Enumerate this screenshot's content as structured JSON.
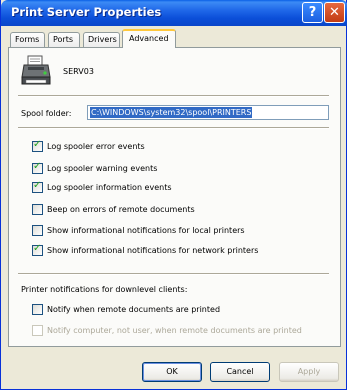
{
  "window": {
    "title": "Print Server Properties"
  },
  "title_buttons": {
    "help": "?",
    "close": "✕"
  },
  "tabs": [
    {
      "label": "Forms"
    },
    {
      "label": "Ports"
    },
    {
      "label": "Drivers"
    },
    {
      "label": "Advanced"
    }
  ],
  "server": {
    "name": "SERV03"
  },
  "spool": {
    "label": "Spool folder:",
    "value": "C:\\WINDOWS\\system32\\spool\\PRINTERS"
  },
  "options": [
    {
      "label": "Log spooler error events",
      "checked": true
    },
    {
      "label": "Log spooler warning events",
      "checked": true
    },
    {
      "label": "Log spooler information events",
      "checked": true
    },
    {
      "label": "Beep on errors of remote documents",
      "checked": false
    },
    {
      "label": "Show informational notifications for local printers",
      "checked": false
    },
    {
      "label": "Show informational notifications for network printers",
      "checked": true
    }
  ],
  "downlevel": {
    "heading": "Printer notifications for downlevel clients:",
    "notify_remote": {
      "label": "Notify when remote documents are printed",
      "checked": false
    },
    "notify_computer": {
      "label": "Notify computer, not user, when remote documents are printed",
      "checked": false,
      "disabled": true
    }
  },
  "buttons": {
    "ok": "OK",
    "cancel": "Cancel",
    "apply": "Apply"
  }
}
